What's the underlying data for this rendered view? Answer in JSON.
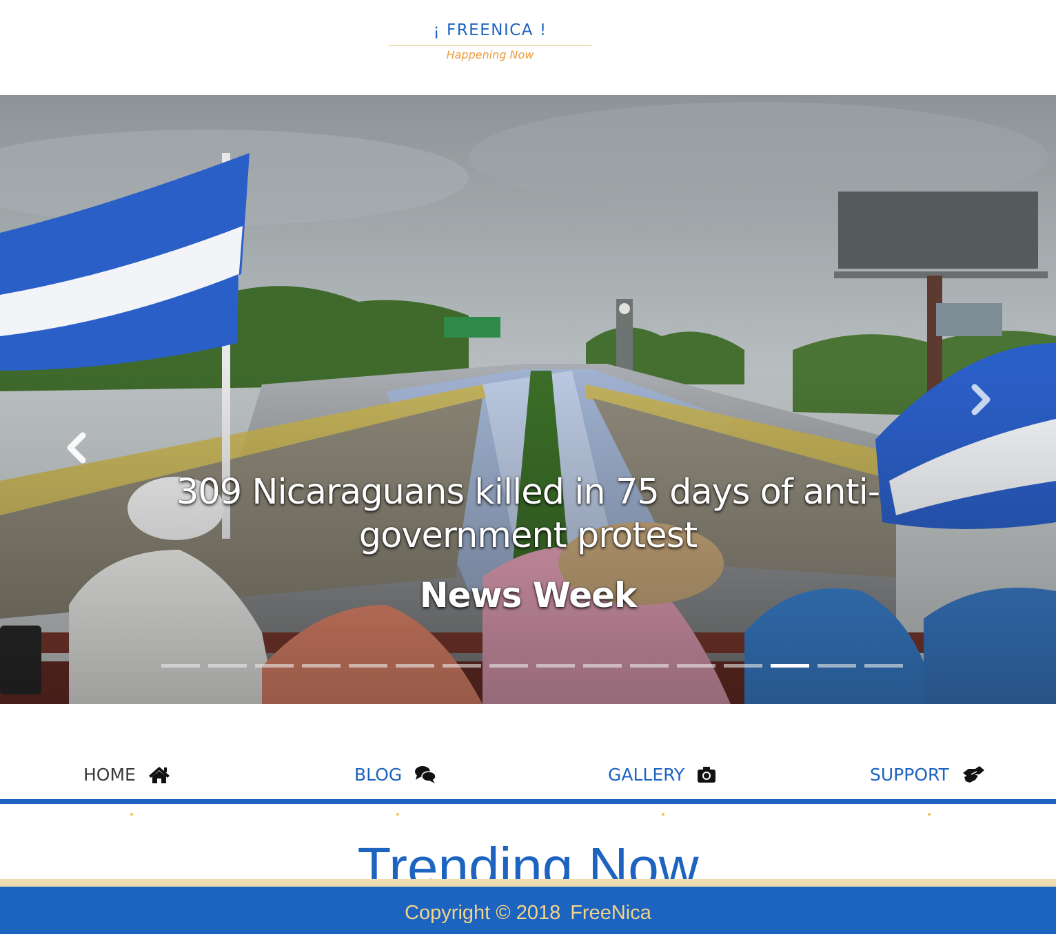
{
  "header": {
    "logo_title": "¡ FREENICA !",
    "logo_tagline": "Happening Now"
  },
  "carousel": {
    "slide_title": "309 Nicaraguans killed in 75 days of anti-government protest",
    "slide_source": "News Week",
    "indicator_count": 16,
    "active_indicator": 13,
    "prev_icon": "chevron-left-icon",
    "next_icon": "chevron-right-icon"
  },
  "nav": {
    "items": [
      {
        "label": "HOME",
        "icon": "home-icon"
      },
      {
        "label": "BLOG",
        "icon": "comments-icon"
      },
      {
        "label": "GALLERY",
        "icon": "camera-icon"
      },
      {
        "label": "SUPPORT",
        "icon": "handshake-icon"
      }
    ]
  },
  "section": {
    "heading": "Trending Now"
  },
  "footer": {
    "copyright": "Copyright © 2018",
    "brand": "FreeNica"
  },
  "colors": {
    "brand_blue": "#1d63c0",
    "accent_orange": "#ef9a3a",
    "footer_text": "#f2d489",
    "gold_rule": "#eddcb0"
  }
}
